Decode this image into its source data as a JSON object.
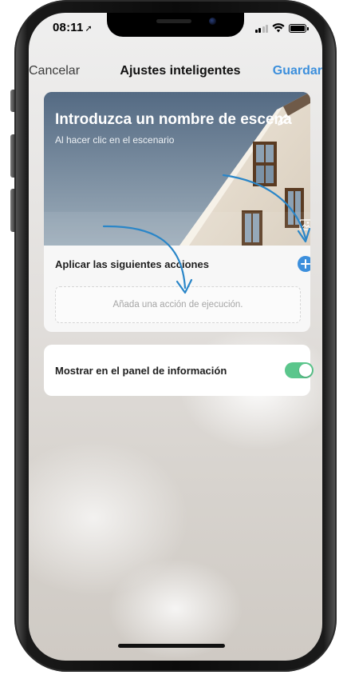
{
  "status_bar": {
    "time": "08:11",
    "location_glyph": "➚",
    "icons": [
      "signal-icon",
      "wifi-icon",
      "battery-icon"
    ]
  },
  "navbar": {
    "cancel_label": "Cancelar",
    "title": "Ajustes inteligentes",
    "save_label": "Guardar"
  },
  "scene": {
    "name_placeholder": "Introduzca un nombre de escena",
    "subtitle": "Al hacer clic en el escenario",
    "edit_icon": "pencil-icon",
    "image_icon": "image-icon"
  },
  "actions": {
    "label": "Aplicar las siguientes acciones",
    "add_icon": "plus-icon",
    "empty_placeholder": "Añada una acción de ejecución."
  },
  "dashboard_toggle": {
    "label": "Mostrar en el panel de información",
    "enabled": true
  },
  "colors": {
    "accent": "#3c8fdc",
    "toggle_on": "#5bc68c",
    "annotation_arrow": "#2a86c8"
  }
}
